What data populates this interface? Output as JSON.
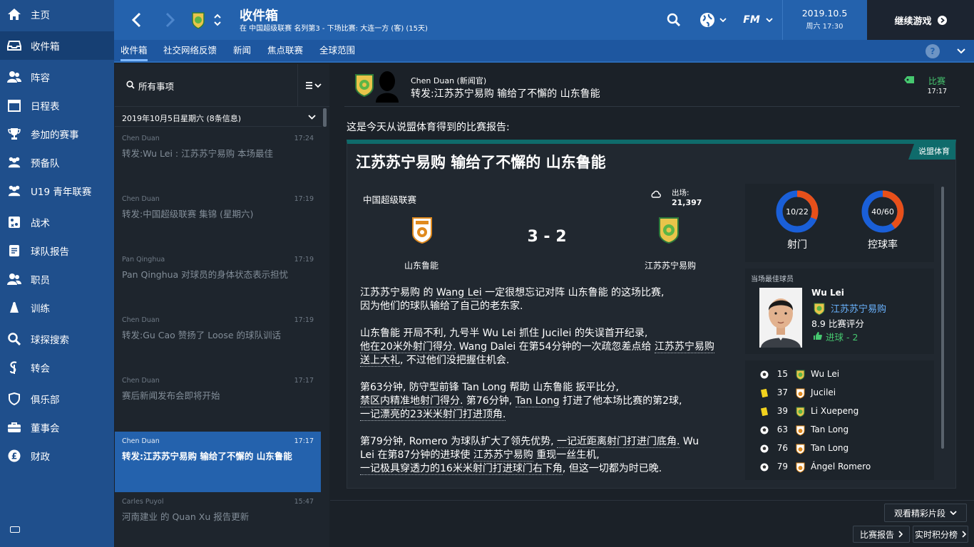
{
  "sidebar": {
    "items": [
      {
        "label": "主页",
        "icon": "home-icon"
      },
      {
        "label": "收件箱",
        "icon": "inbox-icon"
      },
      {
        "label": "阵容",
        "icon": "squad-icon"
      },
      {
        "label": "日程表",
        "icon": "calendar-icon"
      },
      {
        "label": "参加的赛事",
        "icon": "trophy-icon"
      },
      {
        "label": "预备队",
        "icon": "reserve-team-icon"
      },
      {
        "label": "U19 青年联赛",
        "icon": "u19-team-icon"
      },
      {
        "label": "战术",
        "icon": "tactics-icon"
      },
      {
        "label": "球队报告",
        "icon": "team-report-icon"
      },
      {
        "label": "职员",
        "icon": "staff-icon"
      },
      {
        "label": "训练",
        "icon": "training-icon"
      },
      {
        "label": "球探搜索",
        "icon": "scouting-search-icon"
      },
      {
        "label": "转会",
        "icon": "transfers-icon"
      },
      {
        "label": "俱乐部",
        "icon": "club-icon"
      },
      {
        "label": "董事会",
        "icon": "board-icon"
      },
      {
        "label": "财政",
        "icon": "finance-icon"
      }
    ]
  },
  "header": {
    "title": "收件箱",
    "subtitle": "在 中国超级联赛 名列第3 - 下场比赛: 大连一方 (客) (15天)",
    "date": "2019.10.5",
    "day_time": "周六 17:30",
    "continue_label": "继续游戏",
    "fm_label": "FM"
  },
  "subnav": {
    "tabs": [
      "收件箱",
      "社交网络反馈",
      "新闻",
      "焦点联赛",
      "全球范围"
    ],
    "help": "?"
  },
  "inbox": {
    "search_label": "所有事项",
    "date_group": "2019年10月5日星期六 (8条信息)",
    "messages": [
      {
        "sender": "Chen Duan",
        "time": "17:24",
        "subject": "转发:Wu Lei : 江苏苏宁易购 本场最佳"
      },
      {
        "sender": "Chen Duan",
        "time": "17:19",
        "subject": "转发:中国超级联赛 集锦 (星期六)"
      },
      {
        "sender": "Pan Qinghua",
        "time": "17:19",
        "subject": "Pan Qinghua 对球员的身体状态表示担忧"
      },
      {
        "sender": "Chen Duan",
        "time": "17:19",
        "subject": "转发:Gu Cao 赞扬了 Loose 的球队训话"
      },
      {
        "sender": "Chen Duan",
        "time": "17:17",
        "subject": "赛后新闻发布会即将开始"
      },
      {
        "sender": "Chen Duan",
        "time": "17:17",
        "subject": "转发:江苏苏宁易购 输给了不懈的 山东鲁能"
      },
      {
        "sender": "Carles Puyol",
        "time": "15:47",
        "subject": "河南建业 的 Quan Xu 报告更新"
      }
    ]
  },
  "message": {
    "sender": "Chen Duan  (新闻官)",
    "subject": "转发:江苏苏宁易购 输给了不懈的 山东鲁能",
    "tag": "比赛",
    "time": "17:17",
    "intro": "这是今天从说盟体育得到的比赛报告:"
  },
  "report": {
    "source": "说盟体育",
    "title": "江苏苏宁易购 输给了不懈的 山东鲁能",
    "league": "中国超级联赛",
    "attendance_label": "出场:",
    "attendance": "21,397",
    "score": "3 - 2",
    "home_team": "山东鲁能",
    "away_team": "江苏苏宁易购",
    "para1": {
      "a": "江苏苏宁易购",
      "b": " 的 ",
      "c": "Wang Lei",
      "d": " 一定很想忘记对阵 山东鲁能 的这场比赛,",
      "e": "因为他们的球队输给了自己的老东家."
    },
    "para2": {
      "a": "山东鲁能 开局不利, 九号半 Wu Lei 抓住 Jucilei 的失误首开纪录,",
      "b": "他在20米外射门得分.",
      "c": " Wang Dalei 在第54分钟的一次疏忽差点给 ",
      "d": "江苏苏宁易购",
      "e": "送上大礼",
      "f": ", 不过他们没把握住机会."
    },
    "para3": {
      "a": "第63分钟, 防守型前锋 Tan Long 帮助 山东鲁能 扳平比分,",
      "b": "禁区内精准地射门得分.",
      "c": " 第76分钟, ",
      "d": "Tan Long",
      "e": " 打进了他本场比赛的第2球,",
      "f": "一记漂亮的23米米射门打进顶角."
    },
    "para4": {
      "a": "第79分钟, Romero 为球队扩大了领先优势, ",
      "b": "一记近距离射门打进门底角.",
      "c": " Wu",
      "d": "Lei 在第87分钟的进球使 ",
      "e": "江苏苏宁易购",
      "f": " 重现一丝生机,",
      "g": "一记极具穿透力的16米米射门打进球门右下角",
      "h": ", 但这一切都为时已晚."
    }
  },
  "stats": {
    "shots": {
      "value": "10/22",
      "label": "射门",
      "home": 10,
      "away": 22
    },
    "possession": {
      "value": "40/60",
      "label": "控球率",
      "home": 40,
      "away": 60
    },
    "home_color": "#e8501a",
    "away_color": "#1a5fd8"
  },
  "best_player": {
    "title": "当场最佳球员",
    "name": "Wu Lei",
    "club": "江苏苏宁易购",
    "rating": "8.9 比赛评分",
    "goals": "进球 - 2"
  },
  "events": [
    {
      "type": "goal",
      "minute": "15",
      "team": "away",
      "player": "Wu Lei"
    },
    {
      "type": "yellow-card",
      "minute": "37",
      "team": "home",
      "player": "Jucilei"
    },
    {
      "type": "yellow-card",
      "minute": "39",
      "team": "away",
      "player": "Li Xuepeng"
    },
    {
      "type": "goal",
      "minute": "63",
      "team": "home",
      "player": "Tan Long"
    },
    {
      "type": "goal",
      "minute": "76",
      "team": "home",
      "player": "Tan Long"
    },
    {
      "type": "goal",
      "minute": "79",
      "team": "home",
      "player": "Ángel Romero"
    }
  ],
  "bottom": {
    "highlights": "观看精彩片段",
    "match_report": "比赛报告",
    "live_table": "实时积分榜"
  },
  "colors": {
    "sidebar": "#1f4f8c",
    "header": "#2462ad",
    "accent_green": "#46c76f",
    "report_teal": "#0f6b6b"
  }
}
